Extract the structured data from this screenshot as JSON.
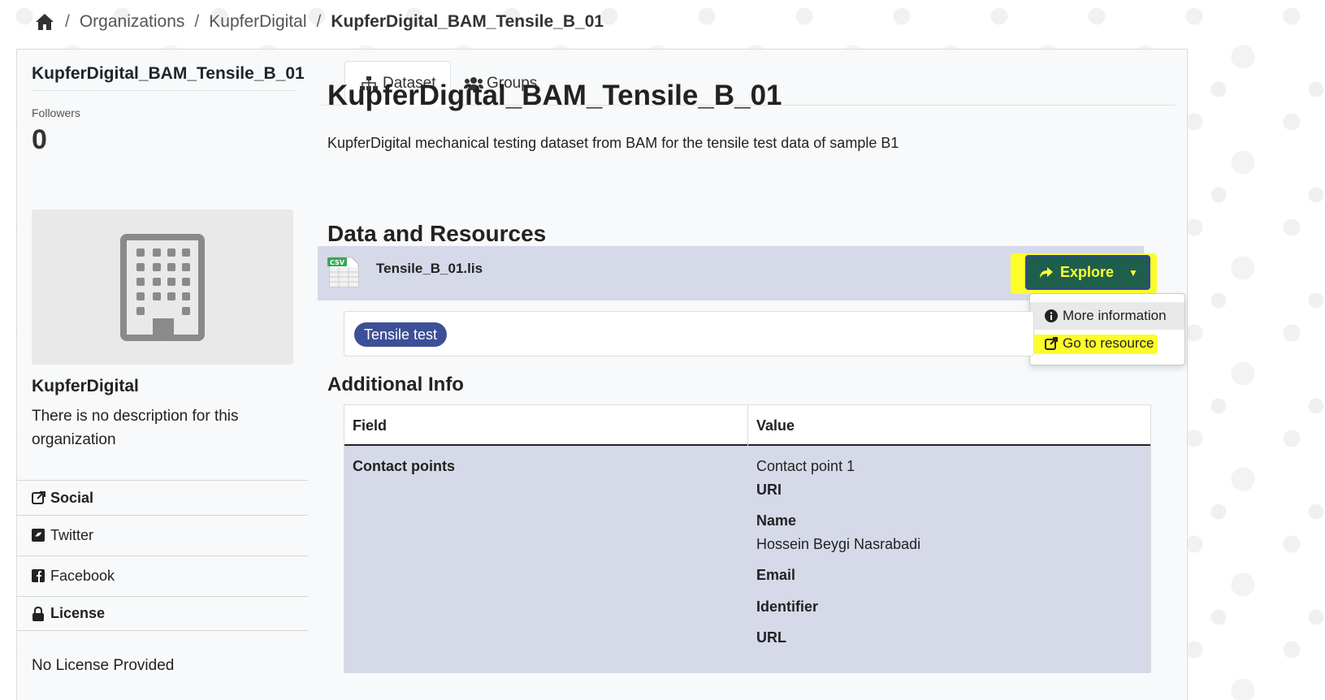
{
  "breadcrumb": {
    "items": [
      "Organizations",
      "KupferDigital"
    ],
    "active": "KupferDigital_BAM_Tensile_B_01",
    "separator": "/"
  },
  "sidebar": {
    "title": "KupferDigital_BAM_Tensile_B_01",
    "followers_label": "Followers",
    "followers_count": "0",
    "org_name": "KupferDigital",
    "org_description": "There is no description for this organization",
    "social_heading": "Social",
    "twitter_label": "Twitter",
    "facebook_label": "Facebook",
    "license_heading": "License",
    "license_text": "No License Provided"
  },
  "tabs": [
    {
      "label": "Dataset",
      "icon": "sitemap-icon"
    },
    {
      "label": "Groups",
      "icon": "users-icon"
    }
  ],
  "dataset": {
    "title": "KupferDigital_BAM_Tensile_B_01",
    "description": "KupferDigital mechanical testing dataset from BAM for the tensile test data of sample B1",
    "resources_heading": "Data and Resources",
    "resource_name": "Tensile_B_01.lis",
    "resource_format": "CSV",
    "explore_label": "Explore",
    "dropdown": {
      "more_info": "More information",
      "go_to_resource": "Go to resource"
    },
    "tag": "Tensile test",
    "additional_info_heading": "Additional Info"
  },
  "info_table": {
    "headers": {
      "field": "Field",
      "value": "Value"
    },
    "rows": [
      {
        "field": "Contact points",
        "value": {
          "subtitle": "Contact point 1",
          "uri_label": "URI",
          "name_label": "Name",
          "name_value": "Hossein Beygi Nasrabadi",
          "email_label": "Email",
          "identifier_label": "Identifier",
          "url_label": "URL"
        }
      }
    ]
  },
  "colors": {
    "highlight": "#fdfd2a",
    "explore_bg": "#1e5e4c",
    "tag_bg": "#3d4f96",
    "row_bg": "#d6d9e8"
  }
}
